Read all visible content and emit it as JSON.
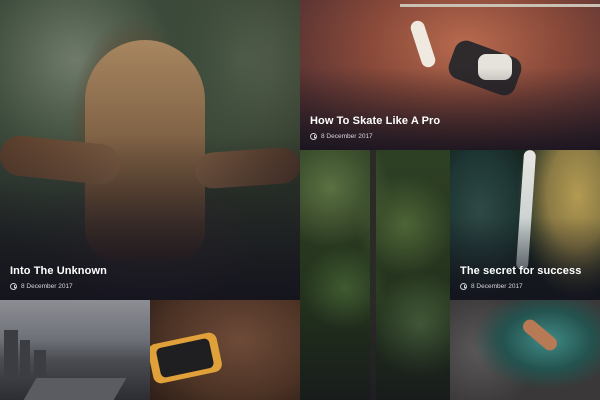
{
  "posts": [
    {
      "id": "unknown",
      "title": "Into The Unknown",
      "date": "8 December 2017",
      "icon": "clock-icon"
    },
    {
      "id": "skate",
      "title": "How To Skate Like A Pro",
      "date": "8 December 2017",
      "icon": "clock-icon"
    },
    {
      "id": "success",
      "title": "The secret for success",
      "date": "8 December 2017",
      "icon": "clock-icon"
    }
  ],
  "colors": {
    "title": "#ffffff",
    "meta": "#d6d6dc",
    "overlay": "#14121e"
  }
}
